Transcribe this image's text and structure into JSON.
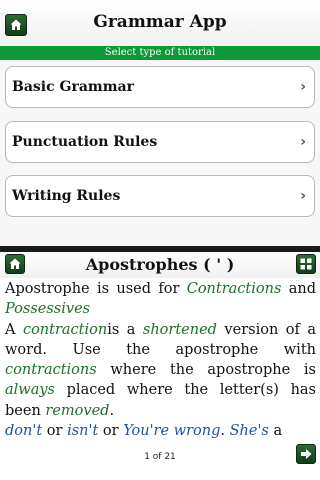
{
  "header": {
    "title": "Grammar App",
    "home_icon": "home-icon"
  },
  "subtitle": "Select type of tutorial",
  "menu": {
    "items": [
      {
        "label": "Basic Grammar",
        "icon": "chevron-right-icon"
      },
      {
        "label": "Punctuation Rules",
        "icon": "chevron-right-icon"
      },
      {
        "label": "Writing Rules",
        "icon": "chevron-right-icon"
      }
    ]
  },
  "lesson": {
    "title": "Apostrophes ( ' )",
    "home_icon": "home-icon",
    "grid_icon": "grid-icon",
    "p1": {
      "t1": "Apostrophe is used for ",
      "g1": "Contractions",
      "t2": " and ",
      "g2": "Possessives"
    },
    "p2": {
      "t1": "A ",
      "g1": "contraction",
      "t2": "is a ",
      "g2": "shortened",
      "t3": " version of a word. Use the apostrophe with ",
      "g3": "contractions",
      "t4": " where the apostrophe is ",
      "g4": "always",
      "t5": " placed where the letter(s) has been ",
      "g5": "removed",
      "t6": "."
    },
    "p3": {
      "b1": "don't",
      "t1": " or ",
      "b2": "isn't",
      "t2": " or ",
      "b3": "You're wrong",
      "t3": ". ",
      "b4": "She's",
      "t4": " a great dancer."
    },
    "page_counter": "1 of 21",
    "next_icon": "arrow-right-icon"
  },
  "colors": {
    "subtitle_bar": "#0b9a35",
    "button_green": "#1f5a26",
    "highlight_green": "#1d6f2b",
    "highlight_blue": "#2350a8"
  }
}
